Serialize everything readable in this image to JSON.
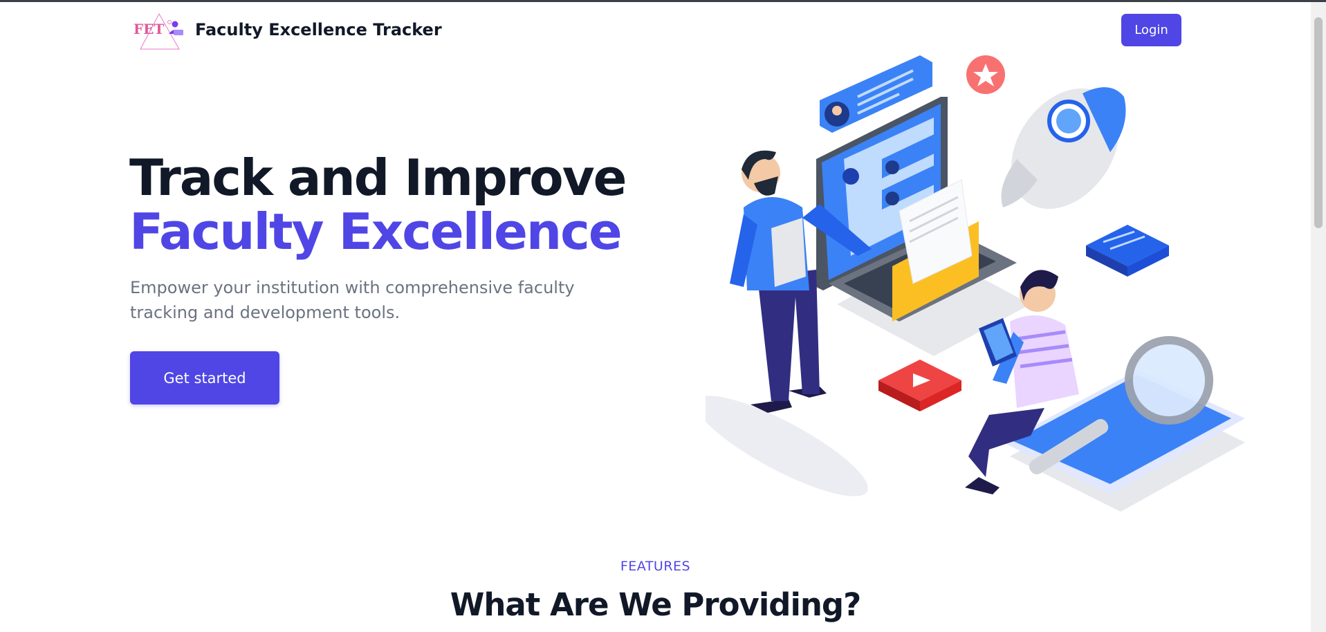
{
  "header": {
    "logo_text": "FET",
    "brand_name": "Faculty Excellence Tracker",
    "login_label": "Login"
  },
  "hero": {
    "title_line1": "Track and Improve",
    "title_line2": "Faculty Excellence",
    "description": "Empower your institution with comprehensive faculty tracking and development tools.",
    "cta_label": "Get started"
  },
  "features": {
    "eyebrow": "FEATURES",
    "title": "What Are We Providing?"
  },
  "colors": {
    "accent": "#4f46e5",
    "heading": "#111827",
    "muted": "#6b7280"
  }
}
